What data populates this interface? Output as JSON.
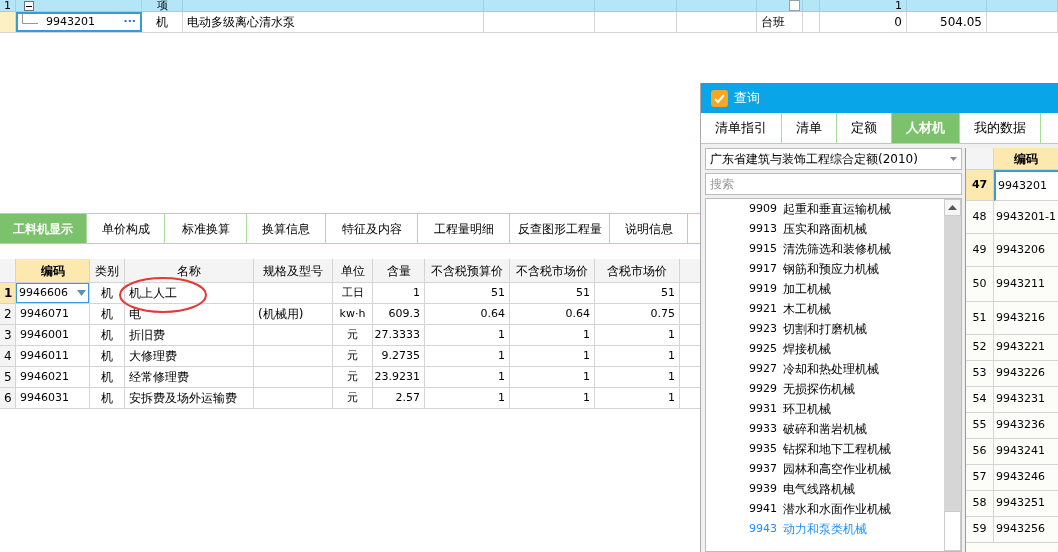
{
  "top_table": {
    "rows": [
      {
        "number": "1",
        "expanded": true,
        "type": "项",
        "checkbox": false,
        "quantity": "1"
      },
      {
        "code": "9943201",
        "more": "···",
        "type": "机",
        "name": "电动多级离心清水泵",
        "unit": "台班",
        "quantity": "0",
        "price": "504.05"
      }
    ]
  },
  "detail_tabs": [
    {
      "label": "工料机显示",
      "selected": true
    },
    {
      "label": "单价构成",
      "selected": false
    },
    {
      "label": "标准换算",
      "selected": false
    },
    {
      "label": "换算信息",
      "selected": false
    },
    {
      "label": "特征及内容",
      "selected": false
    },
    {
      "label": "工程量明细",
      "selected": false
    },
    {
      "label": "反查图形工程量",
      "selected": false
    },
    {
      "label": "说明信息",
      "selected": false
    }
  ],
  "detail_table": {
    "columns": [
      "编码",
      "类别",
      "名称",
      "规格及型号",
      "单位",
      "含量",
      "不含税预算价",
      "不含税市场价",
      "含税市场价"
    ],
    "rows": [
      {
        "number": "1",
        "selected": true,
        "cells": [
          "9946606",
          "机",
          "机上人工",
          "",
          "工日",
          "1",
          "51",
          "51",
          "51"
        ]
      },
      {
        "number": "2",
        "selected": false,
        "cells": [
          "9946071",
          "机",
          "电",
          "(机械用)",
          "kw·h",
          "609.3",
          "0.64",
          "0.64",
          "0.75"
        ]
      },
      {
        "number": "3",
        "selected": false,
        "cells": [
          "9946001",
          "机",
          "折旧费",
          "",
          "元",
          "27.3333",
          "1",
          "1",
          "1"
        ]
      },
      {
        "number": "4",
        "selected": false,
        "cells": [
          "9946011",
          "机",
          "大修理费",
          "",
          "元",
          "9.2735",
          "1",
          "1",
          "1"
        ]
      },
      {
        "number": "5",
        "selected": false,
        "cells": [
          "9946021",
          "机",
          "经常修理费",
          "",
          "元",
          "23.9231",
          "1",
          "1",
          "1"
        ]
      },
      {
        "number": "6",
        "selected": false,
        "cells": [
          "9946031",
          "机",
          "安拆费及场外运输费",
          "",
          "元",
          "2.57",
          "1",
          "1",
          "1"
        ]
      }
    ]
  },
  "query_dialog": {
    "title": "查询",
    "tabs": [
      {
        "label": "清单指引",
        "selected": false
      },
      {
        "label": "清单",
        "selected": false
      },
      {
        "label": "定额",
        "selected": false
      },
      {
        "label": "人材机",
        "selected": true
      },
      {
        "label": "我的数据",
        "selected": false
      }
    ],
    "library": "广东省建筑与装饰工程综合定额(2010)",
    "search": {
      "placeholder": "搜索"
    },
    "categories": [
      {
        "code": "9909",
        "name": "起重和垂直运输机械",
        "selected": false
      },
      {
        "code": "9913",
        "name": "压实和路面机械",
        "selected": false
      },
      {
        "code": "9915",
        "name": "清洗筛选和装修机械",
        "selected": false
      },
      {
        "code": "9917",
        "name": "钢筋和预应力机械",
        "selected": false
      },
      {
        "code": "9919",
        "name": "加工机械",
        "selected": false
      },
      {
        "code": "9921",
        "name": "木工机械",
        "selected": false
      },
      {
        "code": "9923",
        "name": "切割和打磨机械",
        "selected": false
      },
      {
        "code": "9925",
        "name": "焊接机械",
        "selected": false
      },
      {
        "code": "9927",
        "name": "冷却和热处理机械",
        "selected": false
      },
      {
        "code": "9929",
        "name": "无损探伤机械",
        "selected": false
      },
      {
        "code": "9931",
        "name": "环卫机械",
        "selected": false
      },
      {
        "code": "9933",
        "name": "破碎和凿岩机械",
        "selected": false
      },
      {
        "code": "9935",
        "name": "钻探和地下工程机械",
        "selected": false
      },
      {
        "code": "9937",
        "name": "园林和高空作业机械",
        "selected": false
      },
      {
        "code": "9939",
        "name": "电气线路机械",
        "selected": false
      },
      {
        "code": "9941",
        "name": "潜水和水面作业机械",
        "selected": false
      },
      {
        "code": "9943",
        "name": "动力和泵类机械",
        "selected": true
      }
    ],
    "results": {
      "column": "编码",
      "rows": [
        {
          "number": "47",
          "code": "9943201",
          "selected": true
        },
        {
          "number": "48",
          "code": "9943201-1",
          "selected": false
        },
        {
          "number": "49",
          "code": "9943206",
          "selected": false
        },
        {
          "number": "50",
          "code": "9943211",
          "selected": false
        },
        {
          "number": "51",
          "code": "9943216",
          "selected": false
        },
        {
          "number": "52",
          "code": "9943221",
          "selected": false
        },
        {
          "number": "53",
          "code": "9943226",
          "selected": false
        },
        {
          "number": "54",
          "code": "9943231",
          "selected": false
        },
        {
          "number": "55",
          "code": "9943236",
          "selected": false
        },
        {
          "number": "56",
          "code": "9943241",
          "selected": false
        },
        {
          "number": "57",
          "code": "9943246",
          "selected": false
        },
        {
          "number": "58",
          "code": "9943251",
          "selected": false
        },
        {
          "number": "59",
          "code": "9943256",
          "selected": false
        }
      ]
    }
  }
}
